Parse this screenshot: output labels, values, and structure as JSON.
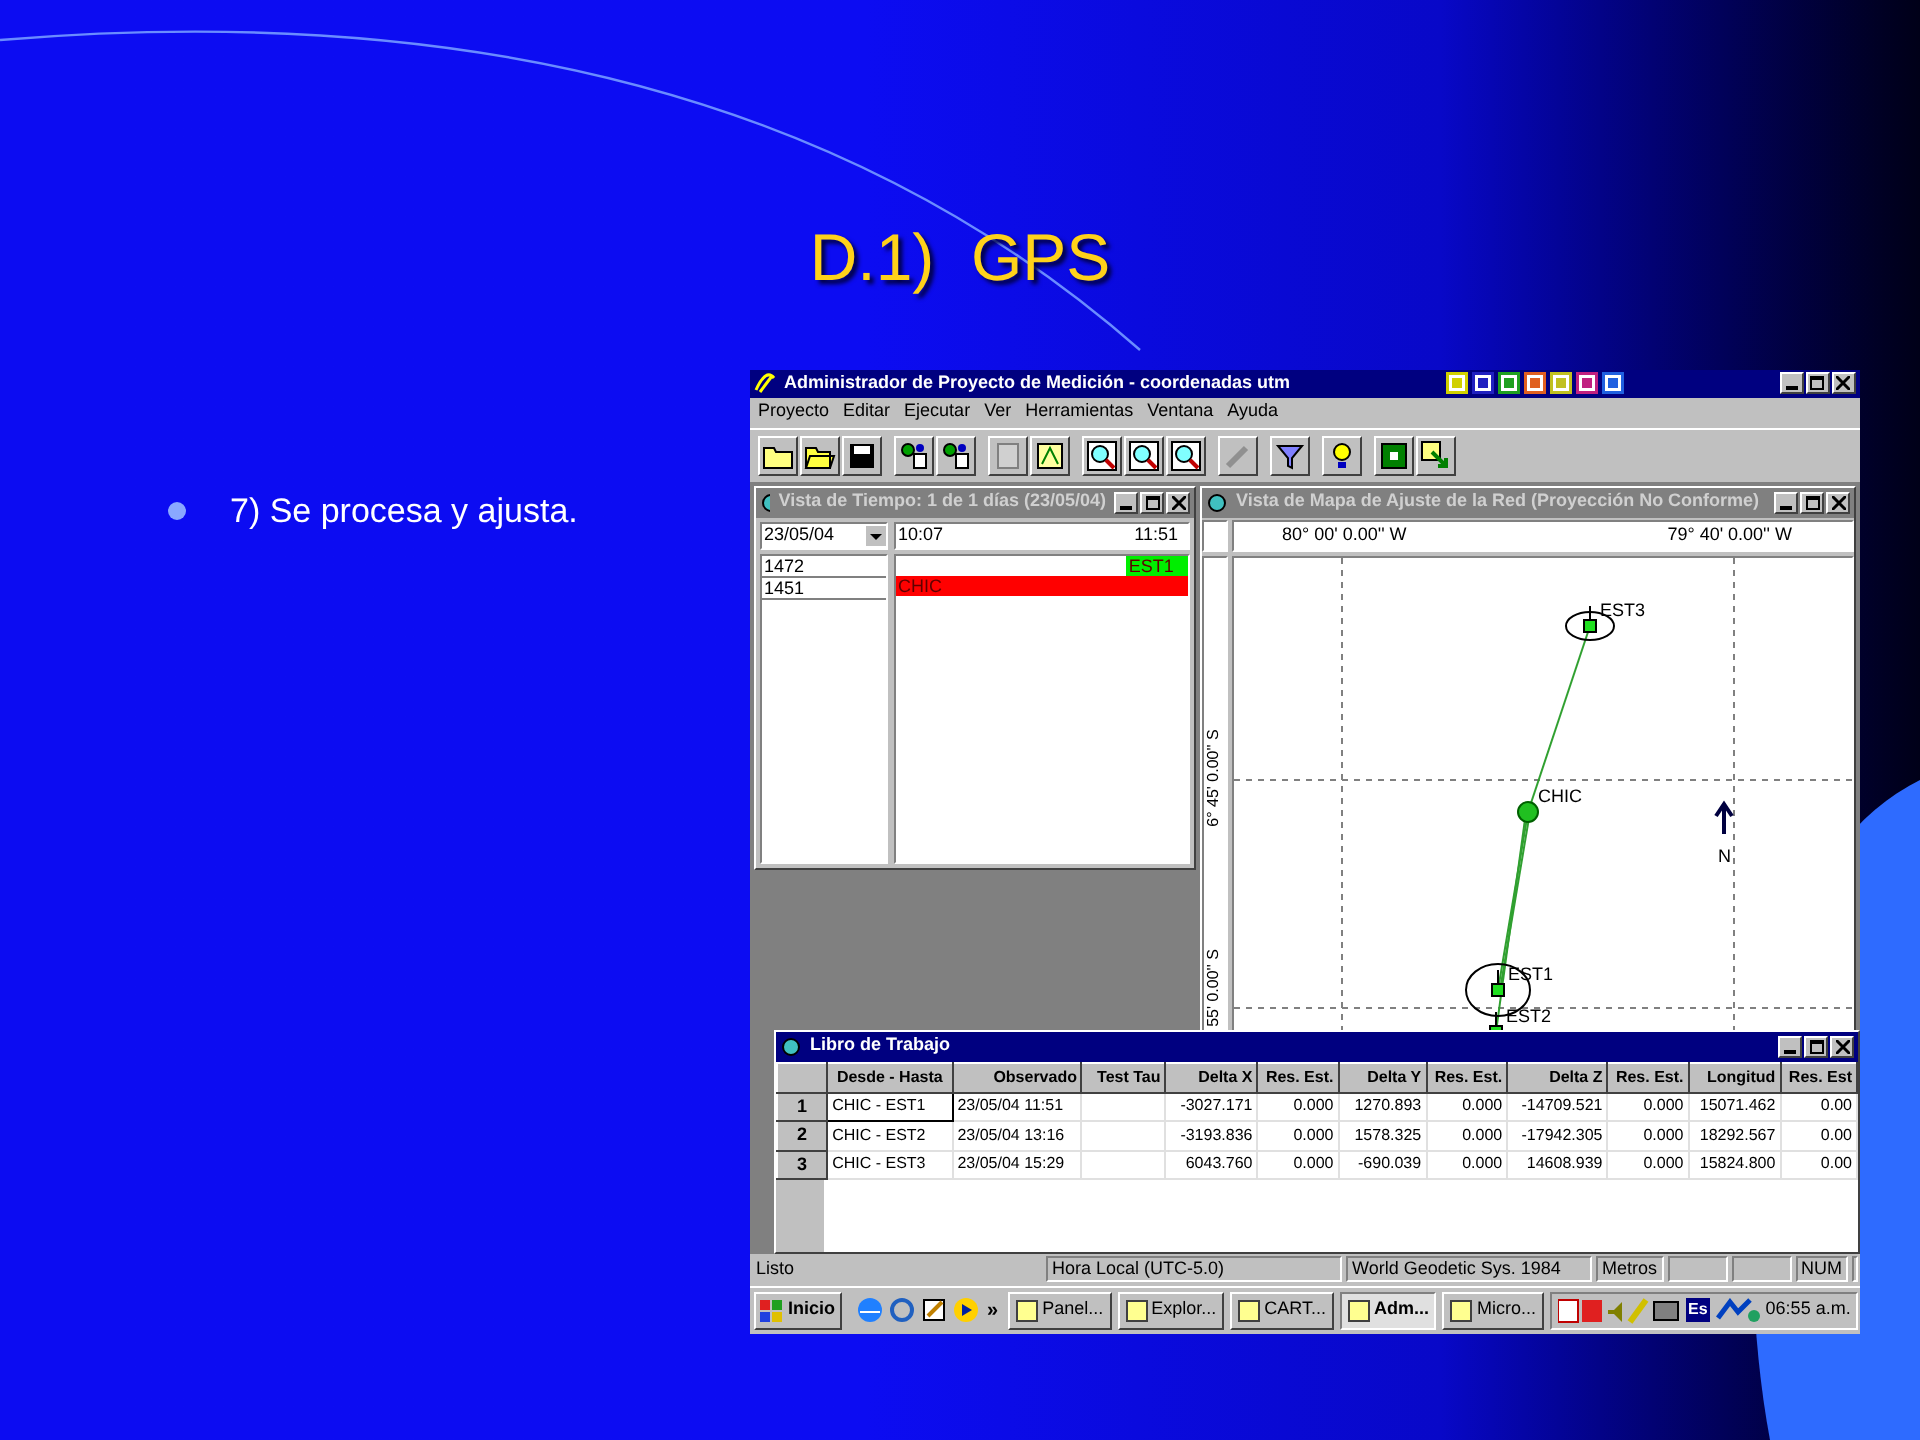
{
  "slide": {
    "title": "D.1)  GPS",
    "bullets": [
      "7) Se procesa y ajusta."
    ]
  },
  "app": {
    "title": "Administrador de Proyecto de Medición - coordenadas utm",
    "menu": [
      "Proyecto",
      "Editar",
      "Ejecutar",
      "Ver",
      "Herramientas",
      "Ventana",
      "Ayuda"
    ],
    "time_view": {
      "title": "Vista de Tiempo: 1 de 1 días (23/05/04)",
      "active": false,
      "date": "23/05/04",
      "start": "10:07",
      "end": "11:51",
      "sessions": [
        "1472",
        "1451"
      ],
      "bars": [
        {
          "label": "EST1",
          "color": "#00ee00",
          "level": 0.21
        },
        {
          "label": "CHIC",
          "color": "#ff0000",
          "level": 1
        }
      ]
    },
    "map_view": {
      "title": "Vista de Mapa de Ajuste de la Red (Proyección No Conforme)",
      "active": false,
      "longitude_labels": [
        "80° 00' 0.00'' W",
        "79° 40' 0.00'' W"
      ],
      "latitude_labels": [
        "6° 45' 0.00'' S",
        "55' 0.00'' S"
      ],
      "stations": [
        {
          "label": "EST3",
          "kind": "station"
        },
        {
          "label": "CHIC",
          "kind": "base"
        },
        {
          "label": "EST1",
          "kind": "station"
        },
        {
          "label": "EST2",
          "kind": "station"
        }
      ],
      "north_label": "N"
    },
    "workbook": {
      "title": "Libro de Trabajo",
      "active": true,
      "columns": [
        "Desde - Hasta",
        "Observado",
        "Test Tau",
        "Delta X",
        "Res. Est.",
        "Delta Y",
        "Res. Est.",
        "Delta Z",
        "Res. Est.",
        "Longitud",
        "Res. Est"
      ],
      "rows": [
        {
          "number": "1",
          "selected": true,
          "cells": [
            "CHIC - EST1",
            "23/05/04 11:51",
            "",
            "-3027.171",
            "0.000",
            "1270.893",
            "0.000",
            "-14709.521",
            "0.000",
            "15071.462",
            "0.00"
          ]
        },
        {
          "number": "2",
          "selected": false,
          "cells": [
            "CHIC - EST2",
            "23/05/04 13:16",
            "",
            "-3193.836",
            "0.000",
            "1578.325",
            "0.000",
            "-17942.305",
            "0.000",
            "18292.567",
            "0.00"
          ]
        },
        {
          "number": "3",
          "selected": false,
          "cells": [
            "CHIC - EST3",
            "23/05/04 15:29",
            "",
            "6043.760",
            "0.000",
            "-690.039",
            "0.000",
            "14608.939",
            "0.000",
            "15824.800",
            "0.00"
          ]
        }
      ]
    },
    "status_bar": [
      "Listo",
      "Hora Local (UTC-5.0)",
      "World Geodetic Sys. 1984",
      "Metros",
      "NUM"
    ],
    "taskbar": {
      "start": "Inicio",
      "more": "»",
      "tasks": [
        {
          "label": "Panel...",
          "selected": false
        },
        {
          "label": "Explor...",
          "selected": false
        },
        {
          "label": "CART...",
          "selected": false
        },
        {
          "label": "Adm...",
          "selected": true
        },
        {
          "label": "Micro...",
          "selected": false
        }
      ],
      "language": "Es",
      "clock": "06:55 a.m."
    }
  }
}
